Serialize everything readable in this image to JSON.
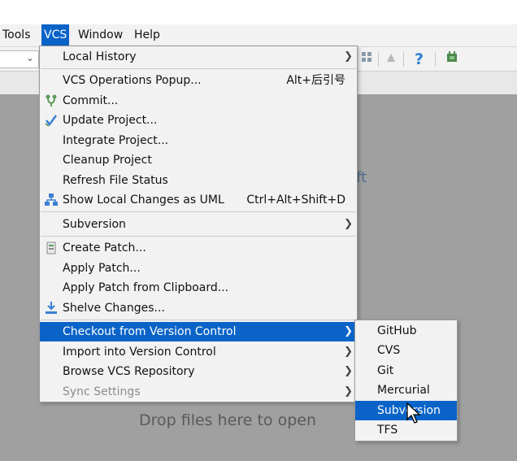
{
  "menubar": {
    "items": [
      {
        "label": "Tools"
      },
      {
        "label": "VCS"
      },
      {
        "label": "Window"
      },
      {
        "label": "Help"
      }
    ]
  },
  "editor": {
    "drop_hint": "Drop files here to open",
    "partial_text": "ft"
  },
  "vcs_menu": {
    "items": [
      {
        "label": "Local History"
      },
      {
        "label": "VCS Operations Popup...",
        "shortcut": "Alt+后引号"
      },
      {
        "label": "Commit..."
      },
      {
        "label": "Update Project..."
      },
      {
        "label": "Integrate Project..."
      },
      {
        "label": "Cleanup Project"
      },
      {
        "label": "Refresh File Status"
      },
      {
        "label": "Show Local Changes as UML",
        "shortcut": "Ctrl+Alt+Shift+D"
      },
      {
        "label": "Subversion"
      },
      {
        "label": "Create Patch..."
      },
      {
        "label": "Apply Patch..."
      },
      {
        "label": "Apply Patch from Clipboard..."
      },
      {
        "label": "Shelve Changes..."
      },
      {
        "label": "Checkout from Version Control"
      },
      {
        "label": "Import into Version Control"
      },
      {
        "label": "Browse VCS Repository"
      },
      {
        "label": "Sync Settings"
      }
    ]
  },
  "checkout_submenu": {
    "items": [
      {
        "label": "GitHub"
      },
      {
        "label": "CVS"
      },
      {
        "label": "Git"
      },
      {
        "label": "Mercurial"
      },
      {
        "label": "Subversion"
      },
      {
        "label": "TFS"
      }
    ]
  },
  "colors": {
    "selection": "#0a64c8",
    "menu_bg": "#f2f2f2",
    "editor_bg": "#a0a0a0"
  },
  "icons": [
    "commit-icon",
    "update-icon",
    "uml-icon",
    "patch-icon",
    "shelve-icon",
    "help-icon",
    "plugin-icon",
    "cursor-icon"
  ]
}
